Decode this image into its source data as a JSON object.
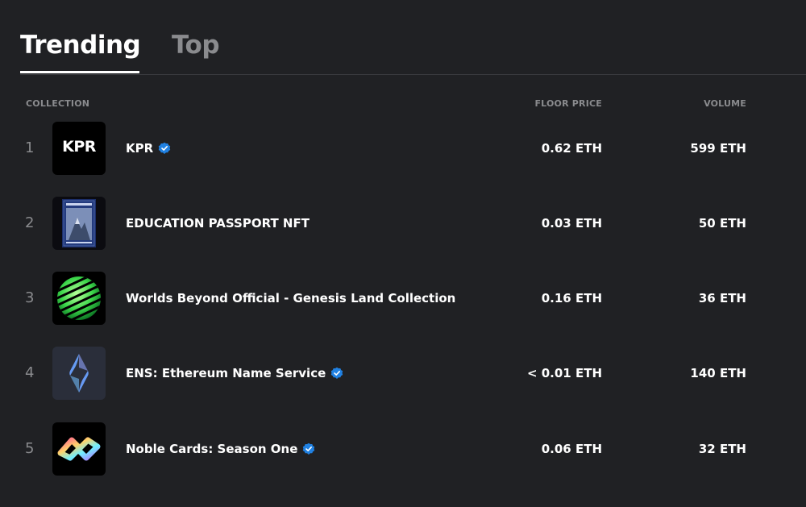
{
  "tabs": {
    "trending": "Trending",
    "top": "Top"
  },
  "columns": {
    "collection": "COLLECTION",
    "floor_price": "FLOOR PRICE",
    "volume": "VOLUME"
  },
  "collections": [
    {
      "rank": "1",
      "name": "KPR",
      "verified": true,
      "floor": "0.62 ETH",
      "volume": "599 ETH",
      "logo_text": "KPR"
    },
    {
      "rank": "2",
      "name": "EDUCATION PASSPORT NFT",
      "verified": false,
      "floor": "0.03 ETH",
      "volume": "50 ETH"
    },
    {
      "rank": "3",
      "name": "Worlds Beyond Official - Genesis Land Collection",
      "verified": false,
      "floor": "0.16 ETH",
      "volume": "36 ETH"
    },
    {
      "rank": "4",
      "name": "ENS: Ethereum Name Service",
      "verified": true,
      "floor": "< 0.01 ETH",
      "volume": "140 ETH"
    },
    {
      "rank": "5",
      "name": "Noble Cards: Season One",
      "verified": true,
      "floor": "0.06 ETH",
      "volume": "32 ETH"
    }
  ],
  "colors": {
    "background": "#202124",
    "muted": "#8a8b8e",
    "verified_blue": "#2081e2"
  }
}
